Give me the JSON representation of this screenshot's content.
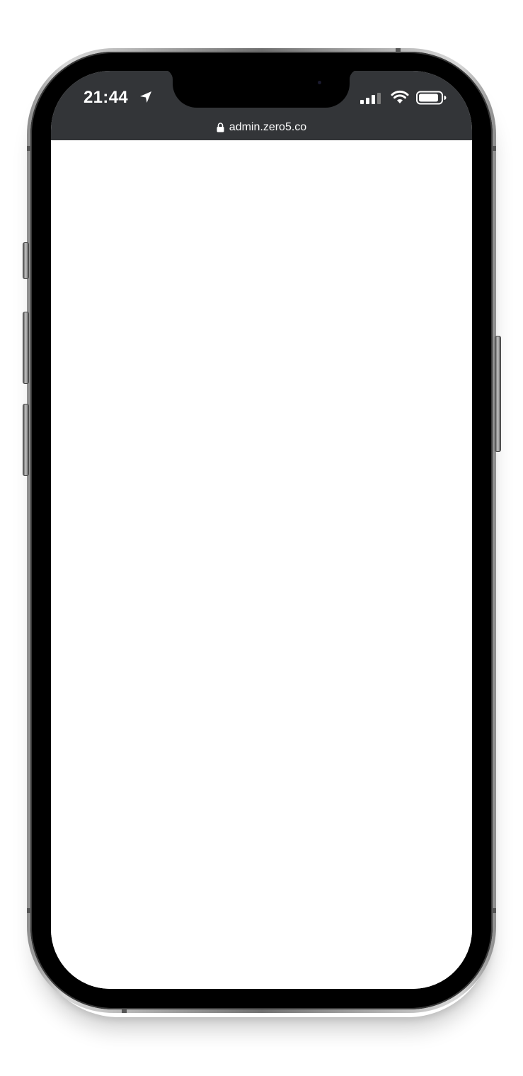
{
  "status_bar": {
    "time": "21:44",
    "location_icon": "location-arrow-icon",
    "signal_icon": "cellular-signal-icon",
    "wifi_icon": "wifi-icon",
    "battery_icon": "battery-icon"
  },
  "browser": {
    "url": "admin.zero5.co",
    "lock_icon": "lock-icon"
  },
  "colors": {
    "status_background": "#333538",
    "page_background": "#ffffff",
    "bezel": "#000000"
  }
}
